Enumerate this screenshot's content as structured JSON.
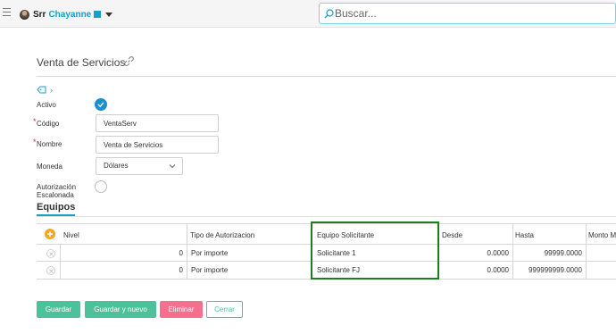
{
  "topbar": {
    "user_prefix": "Srr",
    "user_name": "Chayanne",
    "search_placeholder": "Buscar..."
  },
  "page": {
    "title": "Venta de Servicios",
    "breadcrumb_chevron": "›"
  },
  "form": {
    "activo_label": "Activo",
    "activo_checked": true,
    "codigo_label": "Código",
    "codigo_value": "VentaServ",
    "nombre_label": "Nombre",
    "nombre_value": "Venta de Servicios",
    "moneda_label": "Moneda",
    "moneda_value": "Dólares",
    "autorizacion_label_1": "Autorización",
    "autorizacion_label_2": "Escalonada",
    "autorizacion_checked": false,
    "required_mark": "*"
  },
  "section": {
    "title": "Equipos"
  },
  "table": {
    "columns": [
      "Nivel",
      "Tipo de Autorizacion",
      "Equipo Solicitante",
      "Desde",
      "Hasta",
      "Monto M"
    ],
    "rows": [
      {
        "nivel": "0",
        "tipo": "Por importe",
        "equipo": "Solicitante 1",
        "desde": "0.0000",
        "hasta": "99999.0000"
      },
      {
        "nivel": "0",
        "tipo": "Por importe",
        "equipo": "Solicitante FJ",
        "desde": "0.0000",
        "hasta": "999999999.0000"
      }
    ]
  },
  "buttons": {
    "save": "Guardar",
    "save_new": "Guardar y nuevo",
    "delete": "Eliminar",
    "close": "Cerrar"
  },
  "colors": {
    "accent": "#1aa0c8",
    "success": "#4cc19a",
    "danger": "#f4708d",
    "add": "#f5a623",
    "highlight": "#1e7d1e"
  },
  "icons": [
    "menu-icon",
    "avatar",
    "caret-down-icon",
    "search-icon",
    "link-icon",
    "tag-icon",
    "check-icon",
    "add-icon",
    "remove-icon"
  ]
}
